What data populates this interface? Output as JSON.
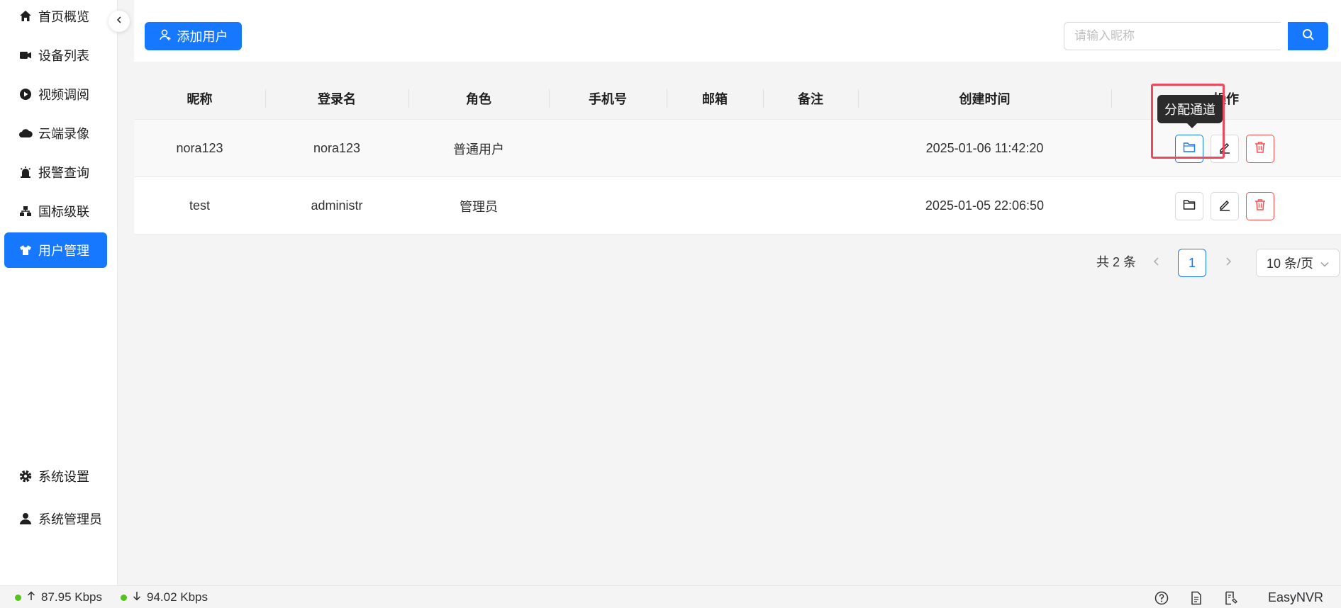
{
  "sidebar": {
    "items": [
      {
        "label": "首页概览",
        "icon": "home-icon"
      },
      {
        "label": "设备列表",
        "icon": "camera-icon"
      },
      {
        "label": "视频调阅",
        "icon": "play-icon"
      },
      {
        "label": "云端录像",
        "icon": "cloud-icon"
      },
      {
        "label": "报警查询",
        "icon": "alarm-icon"
      },
      {
        "label": "国标级联",
        "icon": "cascade-icon"
      },
      {
        "label": "用户管理",
        "icon": "user-shirt-icon",
        "active": true
      }
    ],
    "bottom": [
      {
        "label": "系统设置",
        "icon": "gear-icon"
      },
      {
        "label": "系统管理员",
        "icon": "person-icon"
      }
    ]
  },
  "toolbar": {
    "add_label": "添加用户",
    "search_placeholder": "请输入昵称"
  },
  "table": {
    "headers": [
      "昵称",
      "登录名",
      "角色",
      "手机号",
      "邮箱",
      "备注",
      "创建时间",
      "操作"
    ],
    "rows": [
      {
        "nickname": "nora123",
        "login": "nora123",
        "role": "普通用户",
        "phone": "",
        "email": "",
        "note": "",
        "created": "2025-01-06 11:42:20"
      },
      {
        "nickname": "test",
        "login": "administr",
        "role": "管理员",
        "phone": "",
        "email": "",
        "note": "",
        "created": "2025-01-05 22:06:50"
      }
    ]
  },
  "tooltip": "分配通道",
  "pagination": {
    "total_text": "共 2 条",
    "current_page": "1",
    "page_size": "10 条/页"
  },
  "status": {
    "upload": "87.95 Kbps",
    "download": "94.02 Kbps",
    "brand": "EasyNVR"
  },
  "colors": {
    "accent": "#1677ff",
    "danger": "#ff4d4f",
    "status_ok": "#52c41a",
    "highlight": "#f0475d"
  }
}
